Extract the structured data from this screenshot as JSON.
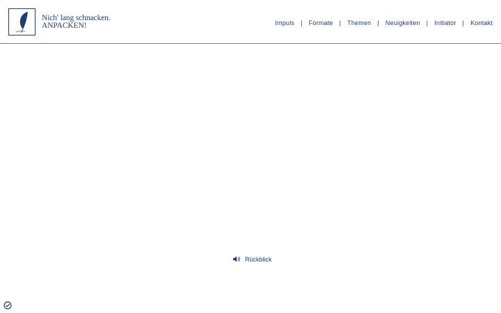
{
  "logo": {
    "line1": "Nich' lang schnacken.",
    "line2": "ANPACKEN!",
    "icon": "quill-icon"
  },
  "nav": {
    "items": [
      {
        "label": "Impuls"
      },
      {
        "label": "Formate"
      },
      {
        "label": "Themen"
      },
      {
        "label": "Neuigkeiten"
      },
      {
        "label": "Initiator"
      },
      {
        "label": "Kontakt"
      }
    ],
    "separator": "|"
  },
  "audio": {
    "label": "Rückblick",
    "icon": "speaker-icon"
  },
  "consent": {
    "icon": "cookie-consent-icon"
  },
  "colors": {
    "brand": "#1f3f73",
    "divider": "#7f7f7f",
    "background": "#ffffff"
  }
}
